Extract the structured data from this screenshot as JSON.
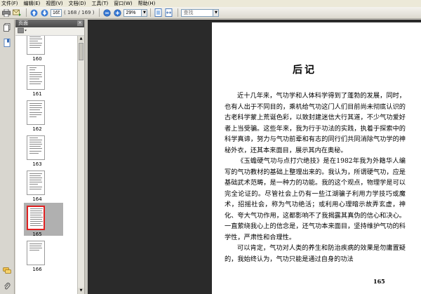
{
  "menu": [
    "文件(F)",
    "编辑(E)",
    "视图(V)",
    "文档(D)",
    "工具(T)",
    "窗口(W)",
    "帮助(H)"
  ],
  "toolbar": {
    "page_input": "165",
    "page_count": "( 168 / 169 )",
    "zoom_value": "29%",
    "search_placeholder": "查找"
  },
  "panel": {
    "title": "页面"
  },
  "thumbnails": [
    {
      "label": "160"
    },
    {
      "label": "161"
    },
    {
      "label": "162"
    },
    {
      "label": "163"
    },
    {
      "label": "164"
    },
    {
      "label": "165",
      "selected": true
    },
    {
      "label": "166"
    }
  ],
  "document": {
    "title": "后记",
    "paragraphs": [
      "近十几年来，气功学和人体科学得到了蓬勃的发展，同时，也有人出于不同目的，乘机给气功这门人们目前尚未彻底认识的古老科学蒙上荒诞色彩，以致封建迷信大行其道，不少气功爱好者上当受骗。这些年来，我为行于功法的实践，执着于探索中的科学真谛，努力与气功前辈和有志的同行们共同消除气功学的神秘外衣，还其本来面目，展示其内在奥秘。",
      "《玉蟾硬气功与点打穴绝技》是在1982年我为外籍华人编写的气功教材的基础上整理出来的。我认为，所谓硬气功，应是基础武术范畴，是一种力的功能。我的这个观点，物理学是可以完全论证的。尽管社会上仍有一些江湖骗子利用力学技巧或魔术，招摇社会，称为气功绝活；或利用心理暗示故弄玄虚，神化、夸大气功作用，这都影响不了我揭露其真伪的信心和决心。一直萦绕我心上的信念是，还气功本来面目，坚持维护气功的科学性，严肃性和合理性。",
      "可以肯定，气功对人类的养生和防治疾病的效果是勿庸置疑的，我始终认为，气功只能是通过自身的功法"
    ],
    "page_number": "165"
  },
  "icons": {
    "print": "printer-icon",
    "mail": "mail-icon",
    "up": "arrow-up-icon",
    "down": "arrow-down-icon"
  }
}
